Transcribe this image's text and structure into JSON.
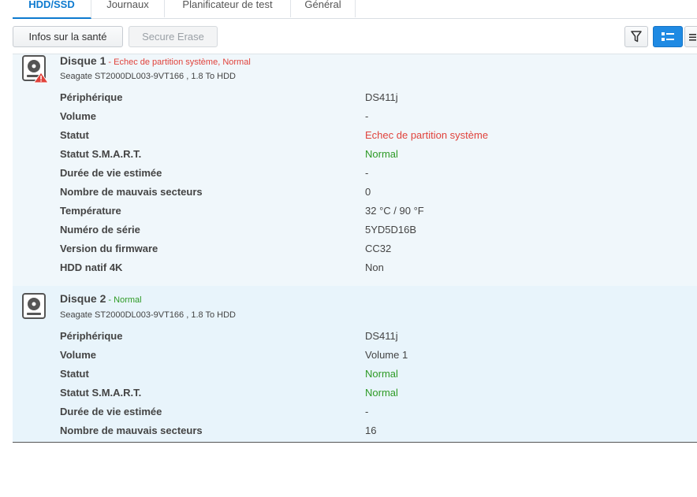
{
  "tabs": [
    {
      "label": "HDD/SSD",
      "active": true
    },
    {
      "label": "Journaux",
      "active": false
    },
    {
      "label": "Planificateur de test",
      "active": false
    },
    {
      "label": "Général",
      "active": false
    }
  ],
  "toolbar": {
    "health_label": "Infos sur la santé",
    "secure_erase_label": "Secure Erase",
    "filter_icon": "filter-icon",
    "list_view_icon": "list-view-icon",
    "detail_view_icon": "detail-view-icon"
  },
  "colors": {
    "error": "#e0423b",
    "ok": "#2d9a25",
    "accent": "#1f8ae3"
  },
  "disks": [
    {
      "title": "Disque 1",
      "separator": " - ",
      "status_summary": "Echec de partition système, Normal",
      "status_color": "error",
      "model": "Seagate ST2000DL003-9VT166 , 1.8 To HDD",
      "warning": true,
      "rows": [
        {
          "key": "Périphérique",
          "value": "DS411j",
          "color": ""
        },
        {
          "key": "Volume",
          "value": "-",
          "color": ""
        },
        {
          "key": "Statut",
          "value": "Echec de partition système",
          "color": "red"
        },
        {
          "key": "Statut S.M.A.R.T.",
          "value": "Normal",
          "color": "green"
        },
        {
          "key": "Durée de vie estimée",
          "value": "-",
          "color": ""
        },
        {
          "key": "Nombre de mauvais secteurs",
          "value": "0",
          "color": ""
        },
        {
          "key": "Température",
          "value": "32 °C / 90 °F",
          "color": ""
        },
        {
          "key": "Numéro de série",
          "value": "5YD5D16B",
          "color": ""
        },
        {
          "key": "Version du firmware",
          "value": "CC32",
          "color": ""
        },
        {
          "key": "HDD natif 4K",
          "value": "Non",
          "color": ""
        }
      ]
    },
    {
      "title": "Disque 2",
      "separator": " - ",
      "status_summary": "Normal",
      "status_color": "ok",
      "model": "Seagate ST2000DL003-9VT166 , 1.8 To HDD",
      "warning": false,
      "rows": [
        {
          "key": "Périphérique",
          "value": "DS411j",
          "color": ""
        },
        {
          "key": "Volume",
          "value": "Volume 1",
          "color": ""
        },
        {
          "key": "Statut",
          "value": "Normal",
          "color": "green"
        },
        {
          "key": "Statut S.M.A.R.T.",
          "value": "Normal",
          "color": "green"
        },
        {
          "key": "Durée de vie estimée",
          "value": "-",
          "color": ""
        },
        {
          "key": "Nombre de mauvais secteurs",
          "value": "16",
          "color": ""
        }
      ]
    }
  ]
}
